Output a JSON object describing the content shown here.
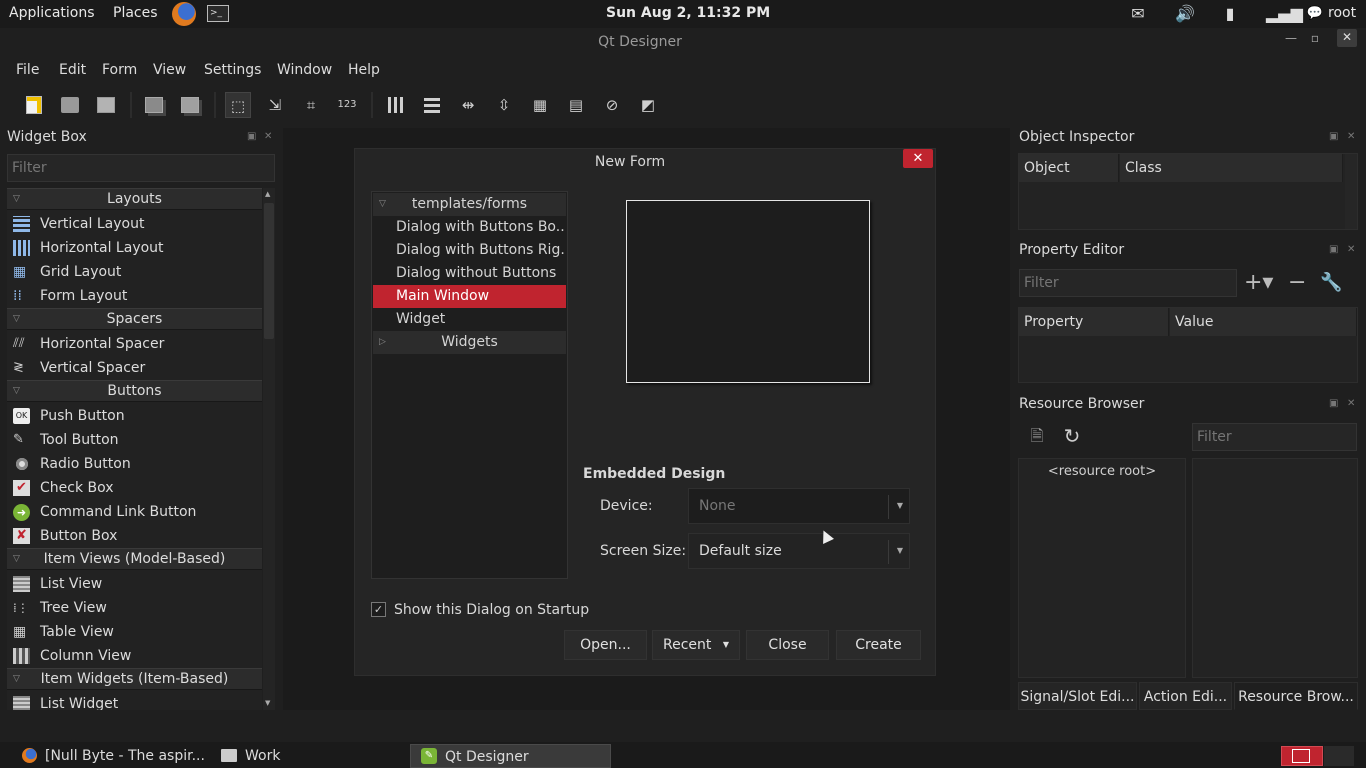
{
  "top_panel": {
    "applications": "Applications",
    "places": "Places",
    "clock": "Sun Aug  2, 11:32 PM",
    "user": "root"
  },
  "window": {
    "title": "Qt Designer"
  },
  "menu": [
    "File",
    "Edit",
    "Form",
    "View",
    "Settings",
    "Window",
    "Help"
  ],
  "widget_box": {
    "title": "Widget Box",
    "filter_placeholder": "Filter",
    "categories": {
      "layouts": "Layouts",
      "spacers": "Spacers",
      "buttons": "Buttons",
      "item_views": "Item Views (Model-Based)",
      "item_widgets": "Item Widgets (Item-Based)"
    },
    "items": {
      "vertical_layout": "Vertical Layout",
      "horizontal_layout": "Horizontal Layout",
      "grid_layout": "Grid Layout",
      "form_layout": "Form Layout",
      "horizontal_spacer": "Horizontal Spacer",
      "vertical_spacer": "Vertical Spacer",
      "push_button": "Push Button",
      "tool_button": "Tool Button",
      "radio_button": "Radio Button",
      "check_box": "Check Box",
      "command_link_button": "Command Link Button",
      "button_box": "Button Box",
      "list_view": "List View",
      "tree_view": "Tree View",
      "table_view": "Table View",
      "column_view": "Column View",
      "list_widget": "List Widget"
    }
  },
  "new_form": {
    "title": "New Form",
    "tree": {
      "root": "templates/forms",
      "dialog_buttons_bottom": "Dialog with Buttons Bo...",
      "dialog_buttons_right": "Dialog with Buttons Rig...",
      "dialog_no_buttons": "Dialog without Buttons",
      "main_window": "Main Window",
      "widget": "Widget",
      "widgets": "Widgets"
    },
    "embedded_design": "Embedded Design",
    "device_label": "Device:",
    "device_value": "None",
    "screen_size_label": "Screen Size:",
    "screen_size_value": "Default size",
    "show_on_startup": "Show this Dialog on Startup",
    "buttons": {
      "open": "Open...",
      "recent": "Recent",
      "close": "Close",
      "create": "Create"
    }
  },
  "object_inspector": {
    "title": "Object Inspector",
    "col_object": "Object",
    "col_class": "Class"
  },
  "property_editor": {
    "title": "Property Editor",
    "filter_placeholder": "Filter",
    "col_property": "Property",
    "col_value": "Value"
  },
  "resource_browser": {
    "title": "Resource Browser",
    "filter_placeholder": "Filter",
    "root": "<resource root>"
  },
  "bottom_tabs": {
    "signal_slot": "Signal/Slot Edi...",
    "action": "Action Edi...",
    "resource": "Resource Brow..."
  },
  "taskbar": {
    "firefox": "[Null Byte - The aspir...",
    "work": "Work",
    "designer": "Qt Designer"
  },
  "colors": {
    "accent": "#c0242f"
  }
}
